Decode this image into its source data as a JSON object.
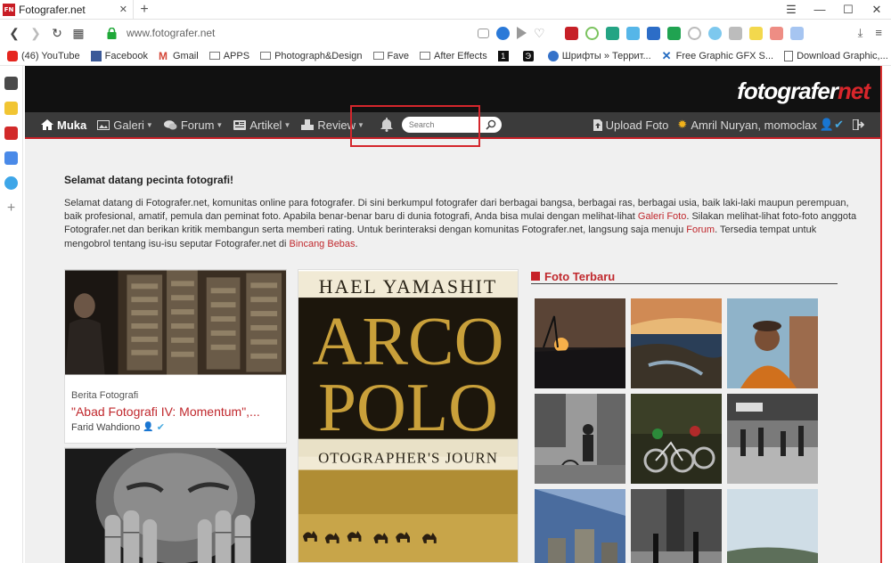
{
  "browser": {
    "tab_title": "Fotografer.net",
    "tab_favicon_text": "FN",
    "url": "www.fotografer.net",
    "bookmarks": [
      "(46) YouTube",
      "Facebook",
      "Gmail",
      "APPS",
      "Photograph&Design",
      "Fave",
      "After Effects",
      "1",
      "Э",
      "Шрифты » Террит...",
      "Free Graphic GFX S...",
      "Download Graphic,..."
    ],
    "bookmarks_more": "»"
  },
  "site": {
    "logo_main": "fotografer",
    "logo_accent": "net",
    "accent_color": "#c62027",
    "nav": {
      "home": "Muka",
      "galeri": "Galeri",
      "forum": "Forum",
      "artikel": "Artikel",
      "review": "Review",
      "search_placeholder": "Search",
      "upload": "Upload Foto",
      "user": "Amril Nuryan, momoclax"
    },
    "welcome_title": "Selamat datang pecinta fotografi!",
    "intro": {
      "p1": "Selamat datang di Fotografer.net, komunitas online para fotografer. Di sini berkumpul fotografer dari berbagai bangsa, berbagai ras, berbagai usia, baik laki-laki maupun perempuan, baik profesional, amatif, pemula dan peminat foto. Apabila benar-benar baru di dunia fotografi, Anda bisa mulai dengan melihat-lihat ",
      "link1": "Galeri Foto",
      "p2": ". Silakan melihat-lihat foto-foto anggota Fotografer.net dan berikan kritik membangun serta memberi rating. Untuk berinteraksi dengan komunitas Fotografer.net, langsung saja menuju ",
      "link2": "Forum",
      "p3": ". Tersedia tempat untuk mengobrol tentang isu-isu seputar Fotografer.net di ",
      "link3": "Bincang Bebas",
      "p4": "."
    },
    "article": {
      "category": "Berita Fotografi",
      "title": "\"Abad Fotografi IV: Momentum\",...",
      "author": "Farid Wahdiono"
    },
    "book_cover": {
      "line1": "HAEL YAMASHIT",
      "line2": "ARCO",
      "line3": "POLO",
      "line4": "OTOGRAPHER'S JOURN"
    },
    "latest_photos_title": "Foto Terbaru"
  }
}
